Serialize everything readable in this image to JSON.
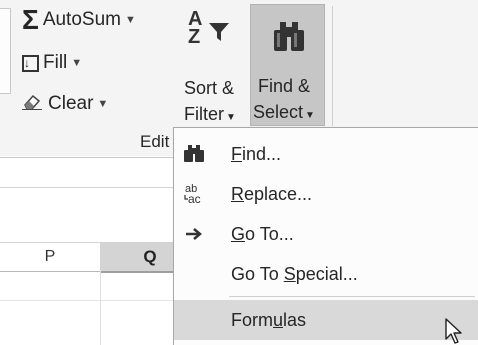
{
  "ribbon": {
    "autosum": {
      "label": "AutoSum",
      "icon": "sigma-icon"
    },
    "fill": {
      "label": "Fill",
      "icon": "fill-down-icon"
    },
    "clear": {
      "label": "Clear",
      "icon": "eraser-icon"
    },
    "sort_filter": {
      "line1": "Sort &",
      "line2": "Filter"
    },
    "find_select": {
      "line1": "Find &",
      "line2": "Select"
    },
    "group_label": "Edit"
  },
  "sheet": {
    "columns": [
      "P",
      "Q"
    ],
    "selected_column": "Q"
  },
  "find_menu": {
    "items": [
      {
        "icon": "binoculars-icon",
        "pre": "",
        "key": "F",
        "post": "ind..."
      },
      {
        "icon": "replace-icon",
        "pre": "",
        "key": "R",
        "post": "eplace..."
      },
      {
        "icon": "arrow-right-icon",
        "pre": "",
        "key": "G",
        "post": "o To..."
      },
      {
        "icon": "",
        "pre": "Go To ",
        "key": "S",
        "post": "pecial..."
      },
      {
        "icon": "",
        "pre": "Form",
        "key": "u",
        "post": "las"
      }
    ],
    "hovered_item": 4
  },
  "colors": {
    "ribbon_bg": "#f4f4f4",
    "find_button_bg": "#c6c6c6",
    "menu_hover": "#d9d9d9"
  }
}
